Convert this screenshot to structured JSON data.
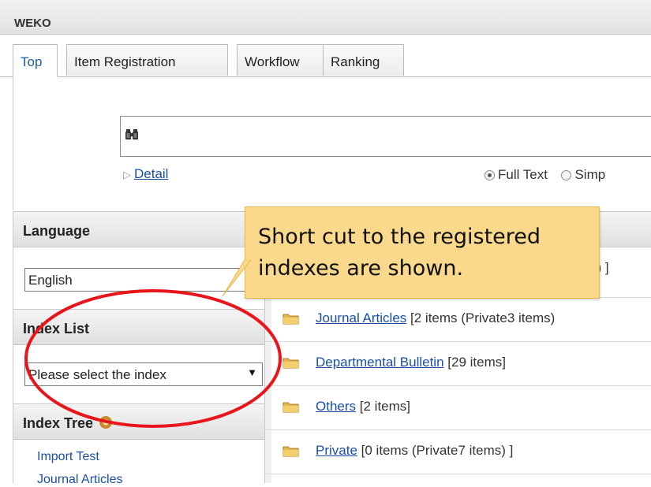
{
  "app": {
    "title": "WEKO"
  },
  "tabs": [
    {
      "label": "Top",
      "active": true
    },
    {
      "label": "Item Registration",
      "active": false
    },
    {
      "label": "Workflow",
      "active": false
    },
    {
      "label": "Ranking",
      "active": false
    }
  ],
  "search": {
    "icon": "binoculars-icon",
    "detail_label": "Detail",
    "modes": [
      {
        "label": "Full Text",
        "selected": true
      },
      {
        "label": "Simp",
        "selected": false
      }
    ]
  },
  "sidebar": {
    "language": {
      "heading": "Language",
      "value": "English"
    },
    "index_list": {
      "heading": "Index List",
      "value": "Please select the index"
    },
    "index_tree": {
      "heading": "Index Tree",
      "items": [
        "Import Test",
        "Journal Articles"
      ]
    }
  },
  "main": {
    "partial_first_row": "s) ]",
    "rows": [
      {
        "name": "Journal Articles",
        "count": "[2 items (Private3 items)"
      },
      {
        "name": "Departmental Bulletin",
        "count": "[29 items]"
      },
      {
        "name": "Others",
        "count": "[2 items]"
      },
      {
        "name": "Private",
        "count": "[0 items (Private7 items) ]"
      }
    ]
  },
  "callout": {
    "text": "Short cut to the registered\nindexes are shown.",
    "color": "#fbd98c"
  },
  "annotation": {
    "color": "#e8151b"
  }
}
